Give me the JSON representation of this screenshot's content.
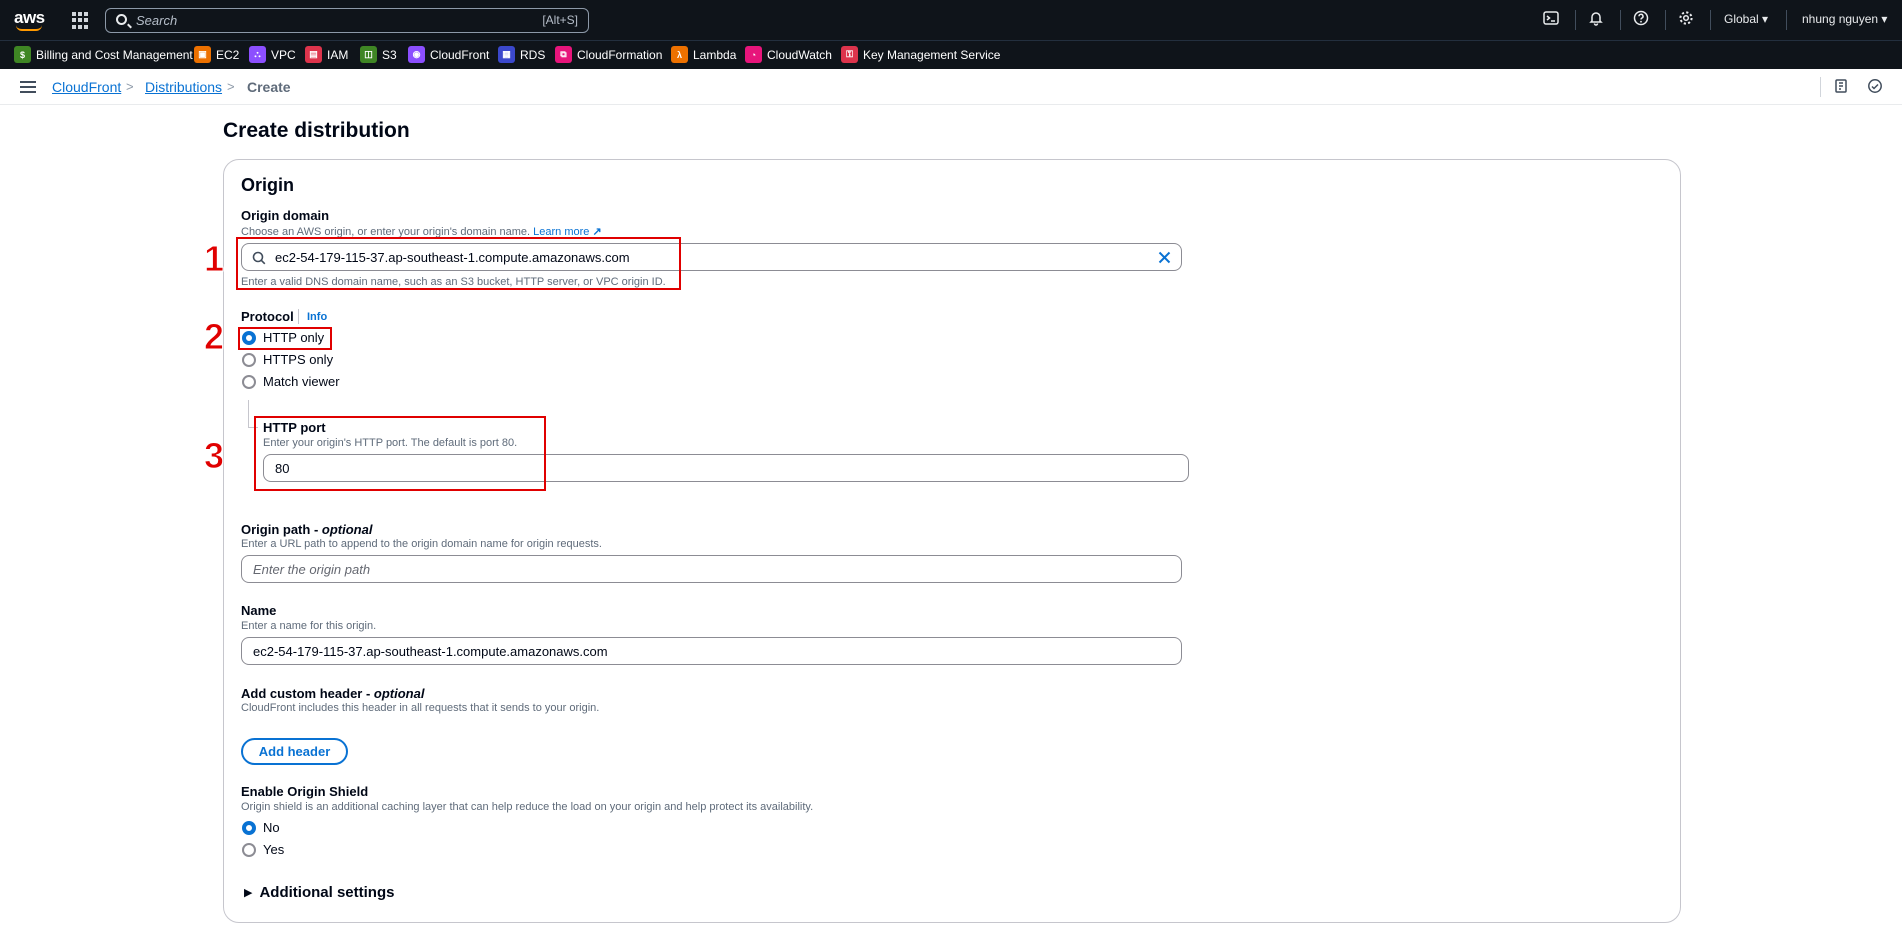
{
  "topnav": {
    "search_placeholder": "Search",
    "search_shortcut": "[Alt+S]",
    "region": "Global ▾",
    "user": "nhung nguyen ▾"
  },
  "favorites": [
    {
      "label": "Billing and Cost Management",
      "color": "#3f8624"
    },
    {
      "label": "EC2",
      "color": "#ed7100"
    },
    {
      "label": "VPC",
      "color": "#8c4fff"
    },
    {
      "label": "IAM",
      "color": "#dd344c"
    },
    {
      "label": "S3",
      "color": "#3f8624"
    },
    {
      "label": "CloudFront",
      "color": "#8c4fff"
    },
    {
      "label": "RDS",
      "color": "#3b48cc"
    },
    {
      "label": "CloudFormation",
      "color": "#e7157b"
    },
    {
      "label": "Lambda",
      "color": "#ed7100"
    },
    {
      "label": "CloudWatch",
      "color": "#e7157b"
    },
    {
      "label": "Key Management Service",
      "color": "#dd344c"
    }
  ],
  "breadcrumb": {
    "items": [
      "CloudFront",
      "Distributions",
      "Create"
    ]
  },
  "page": {
    "title": "Create distribution",
    "section": "Origin"
  },
  "origin_domain": {
    "label": "Origin domain",
    "desc": "Choose an AWS origin, or enter your origin's domain name.",
    "learn_more": "Learn more",
    "value": "ec2-54-179-115-37.ap-southeast-1.compute.amazonaws.com",
    "hint": "Enter a valid DNS domain name, such as an S3 bucket, HTTP server, or VPC origin ID."
  },
  "protocol": {
    "label": "Protocol",
    "info": "Info",
    "options": [
      "HTTP only",
      "HTTPS only",
      "Match viewer"
    ],
    "selected": "HTTP only"
  },
  "http_port": {
    "label": "HTTP port",
    "desc": "Enter your origin's HTTP port. The default is port 80.",
    "value": "80"
  },
  "origin_path": {
    "label": "Origin path - ",
    "label_optional": "optional",
    "desc": "Enter a URL path to append to the origin domain name for origin requests.",
    "placeholder": "Enter the origin path"
  },
  "name": {
    "label": "Name",
    "desc": "Enter a name for this origin.",
    "value": "ec2-54-179-115-37.ap-southeast-1.compute.amazonaws.com"
  },
  "custom_header": {
    "label": "Add custom header - ",
    "label_optional": "optional",
    "desc": "CloudFront includes this header in all requests that it sends to your origin.",
    "button": "Add header"
  },
  "origin_shield": {
    "label": "Enable Origin Shield",
    "desc": "Origin shield is an additional caching layer that can help reduce the load on your origin and help protect its availability.",
    "options": [
      "No",
      "Yes"
    ],
    "selected": "No"
  },
  "additional_settings": "Additional settings",
  "annotations": [
    "1",
    "2",
    "3"
  ],
  "colors": {
    "accent": "#0972d3",
    "annotation": "#e00000",
    "nav_bg": "#0f141a"
  }
}
